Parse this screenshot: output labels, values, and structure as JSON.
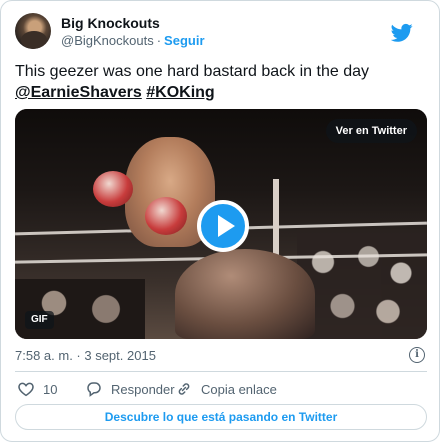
{
  "author": {
    "display_name": "Big Knockouts",
    "handle": "@BigKnockouts",
    "separator": "·",
    "follow_label": "Seguir"
  },
  "tweet": {
    "text": "This geezer was one hard bastard back in the day",
    "mention": "@EarnieShavers",
    "hashtag": "#KOKing"
  },
  "media": {
    "view_on_twitter_label": "Ver en Twitter",
    "badge": "GIF"
  },
  "meta": {
    "timestamp": "7:58 a. m. · 3 sept. 2015",
    "info_icon_glyph": "i"
  },
  "actions": {
    "like_count": "10",
    "reply_label": "Responder",
    "copy_link_label": "Copia enlace"
  },
  "footer": {
    "discover_label": "Descubre lo que está pasando en Twitter"
  },
  "colors": {
    "accent": "#1d9bf0",
    "text_primary": "#0f1419",
    "text_secondary": "#536471",
    "border": "#cfd9de"
  },
  "icons": {
    "brand": "twitter-bird-icon",
    "play": "play-icon",
    "like": "heart-icon",
    "reply": "speech-bubble-icon",
    "copy_link": "link-icon",
    "info": "info-icon"
  }
}
